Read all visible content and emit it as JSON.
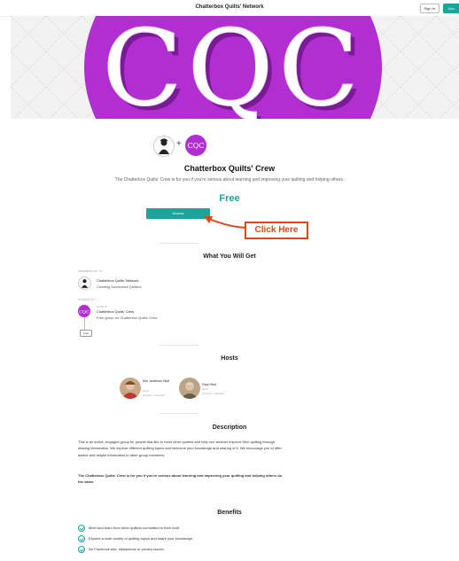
{
  "header": {
    "title": "Chatterbox Quilts' Network",
    "signin_label": "Sign In",
    "join_label": "Join"
  },
  "hero": {
    "logo_text": "CQC",
    "brand_color": "#b12fd0"
  },
  "group": {
    "logo_text": "CQC",
    "name": "Chatterbox Quilts' Crew",
    "description": "The Chatterbox Quilts' Crew is for you if you're serious about learning and improving your quilting and helping others.",
    "price": "Free",
    "access_label": "Access"
  },
  "callout": {
    "label": "Click Here",
    "color": "#e1451e"
  },
  "what_you_get": {
    "title": "What You Will Get",
    "membership_label": "MEMBERSHIP TO",
    "network_name": "Chatterbox Quilts' Network",
    "network_sub": "Creating Successful Quilters",
    "access_label": "ACCESS TO",
    "group_tag": "GROUP",
    "crew_name": "Chatterbox Quilts' Crew",
    "crew_sub": "Free group for Chatterbox Quilts' Crew",
    "free_chip": "Free"
  },
  "hosts": {
    "title": "Hosts",
    "items": [
      {
        "name": "Kim Jamieson Hirst",
        "role": "Host",
        "location": "Ontario, Canada"
      },
      {
        "name": "Gary Hirst",
        "role": "Host",
        "location": "Ontario, Canada"
      }
    ]
  },
  "description": {
    "title": "Description",
    "para1": "This is an active, engaged group for people that like to meet other quilters and help one another improve their quilting through sharing information. We explore different quilting topics and welcome your knowledge and sharing of it. We encourage you to offer advice and helpful information to other group members.",
    "para2": "The Chatterbox Quilts' Crew is for you if you're serious about learning and improving your quilting and helping others do the same."
  },
  "benefits": {
    "title": "Benefits",
    "items": [
      "Meet and learn from other quilters committed to their craft.",
      "Explore a wide variety of quilting topics and share your knowledge.",
      "No Facebook ads, distractions or privacy issues."
    ]
  },
  "colors": {
    "accent": "#1aa79b",
    "brand": "#b12fd0",
    "callout": "#e1451e"
  }
}
